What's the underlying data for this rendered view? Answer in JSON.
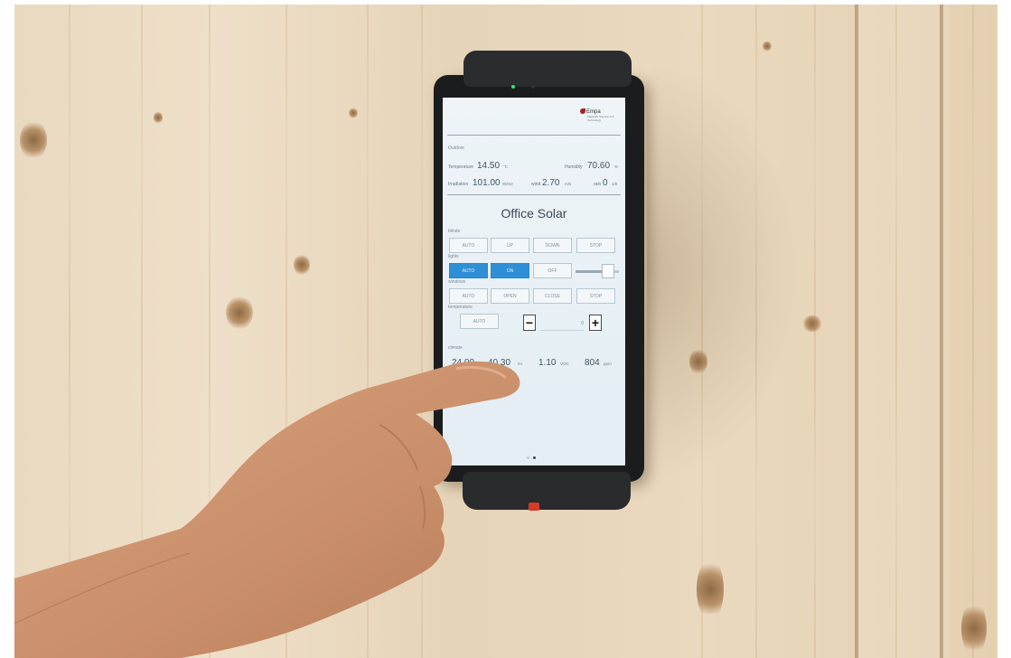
{
  "photo": {
    "subject": ""
  },
  "brand": {
    "name": "Empa",
    "tagline": "Materials Science and Technology"
  },
  "outdoor": {
    "section_label": "Outdoor",
    "temperature": {
      "label": "Temperature",
      "value": "14.50",
      "unit": "°C"
    },
    "humidity": {
      "label": "Humidity",
      "value": "70.60",
      "unit": "%"
    },
    "irradiation": {
      "label": "Irradiation",
      "value": "101.00",
      "unit": "W/m2"
    },
    "wind": {
      "label": "wind",
      "value": "2.70",
      "unit": "m/s"
    },
    "rain": {
      "label": "rain",
      "value": "0",
      "unit": "1/0"
    }
  },
  "room": {
    "title": "Office Solar"
  },
  "blinds": {
    "label": "blinds",
    "buttons": [
      "AUTO",
      "UP",
      "DOWN",
      "STOP"
    ]
  },
  "lights": {
    "label": "lights",
    "buttons": [
      "AUTO",
      "ON",
      "OFF"
    ],
    "active": [
      "AUTO",
      "ON"
    ],
    "dimmer_level": 0.85
  },
  "windows": {
    "label": "windows",
    "buttons": [
      "AUTO",
      "OPEN",
      "CLOSE",
      "STOP"
    ]
  },
  "temperature_control": {
    "label": "temperature",
    "auto_label": "AUTO",
    "minus": "−",
    "plus": "+",
    "setpoint": "0"
  },
  "climate": {
    "label": "climate",
    "readings": [
      {
        "value": "24.00",
        "unit": "°C"
      },
      {
        "value": "40.30",
        "unit": "rH"
      },
      {
        "value": "1.10",
        "unit": "VOC"
      },
      {
        "value": "804",
        "unit": "ppm"
      }
    ]
  },
  "pager": {
    "pages": 2,
    "current": 2
  },
  "colors": {
    "active_button": "#2e8fd6",
    "brand_red": "#a4232a",
    "holder_button": "#d63a2b",
    "camera_led": "#32e07a"
  }
}
